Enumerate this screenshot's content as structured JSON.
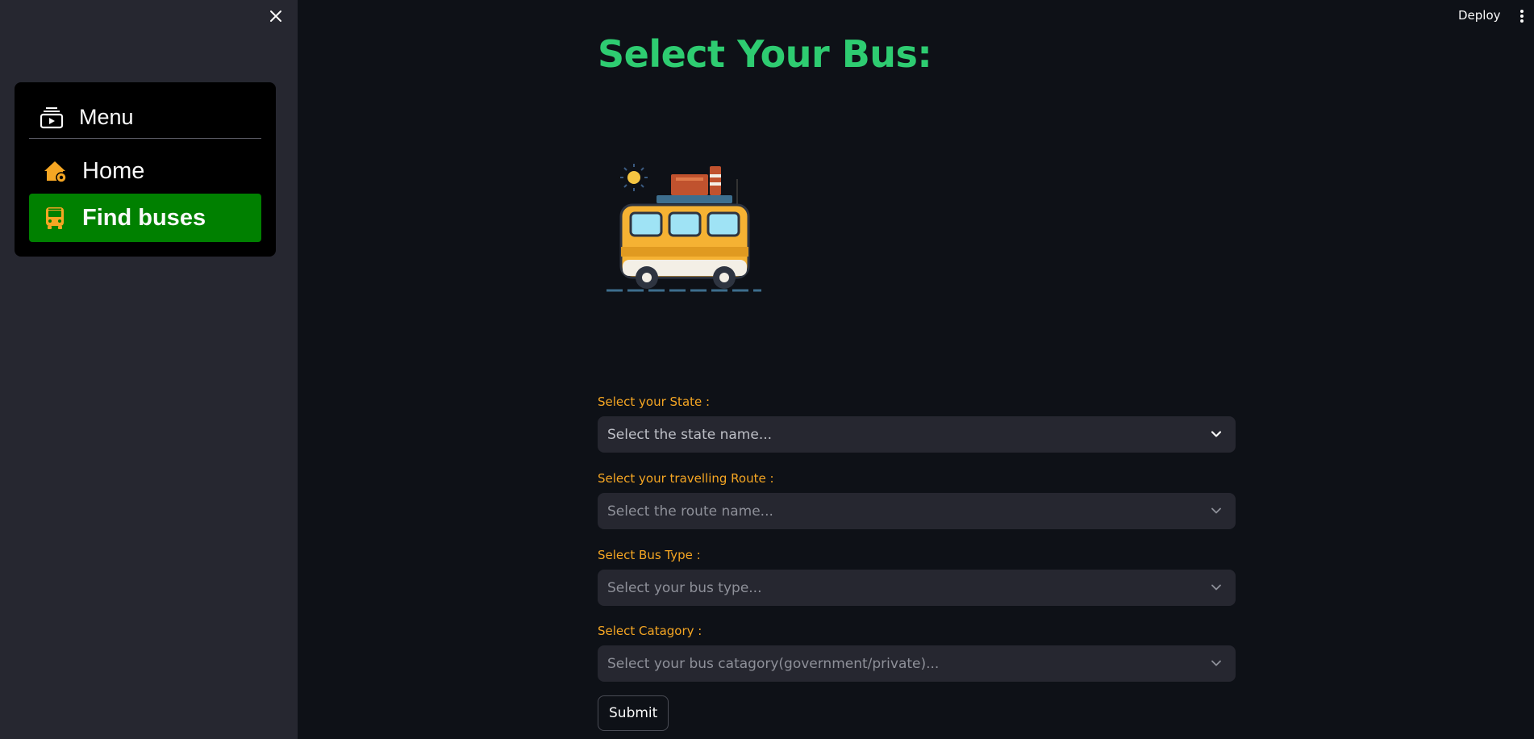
{
  "sidebar": {
    "menu_title": "Menu",
    "items": [
      {
        "label": "Home",
        "icon": "house-gear-icon",
        "active": false
      },
      {
        "label": "Find buses",
        "icon": "bus-icon",
        "active": true
      }
    ],
    "active_color": "#008000"
  },
  "header": {
    "deploy_label": "Deploy"
  },
  "main": {
    "title": "Select Your Bus:",
    "title_color": "#2ecc71",
    "fields": [
      {
        "label": "Select your State :",
        "placeholder": "Select the state name..."
      },
      {
        "label": "Select your travelling Route :",
        "placeholder": "Select the route name..."
      },
      {
        "label": "Select Bus Type :",
        "placeholder": "Select your bus type..."
      },
      {
        "label": "Select Catagory :",
        "placeholder": "Select your bus catagory(government/private)..."
      }
    ],
    "submit_label": "Submit",
    "label_color": "#f5a623"
  }
}
